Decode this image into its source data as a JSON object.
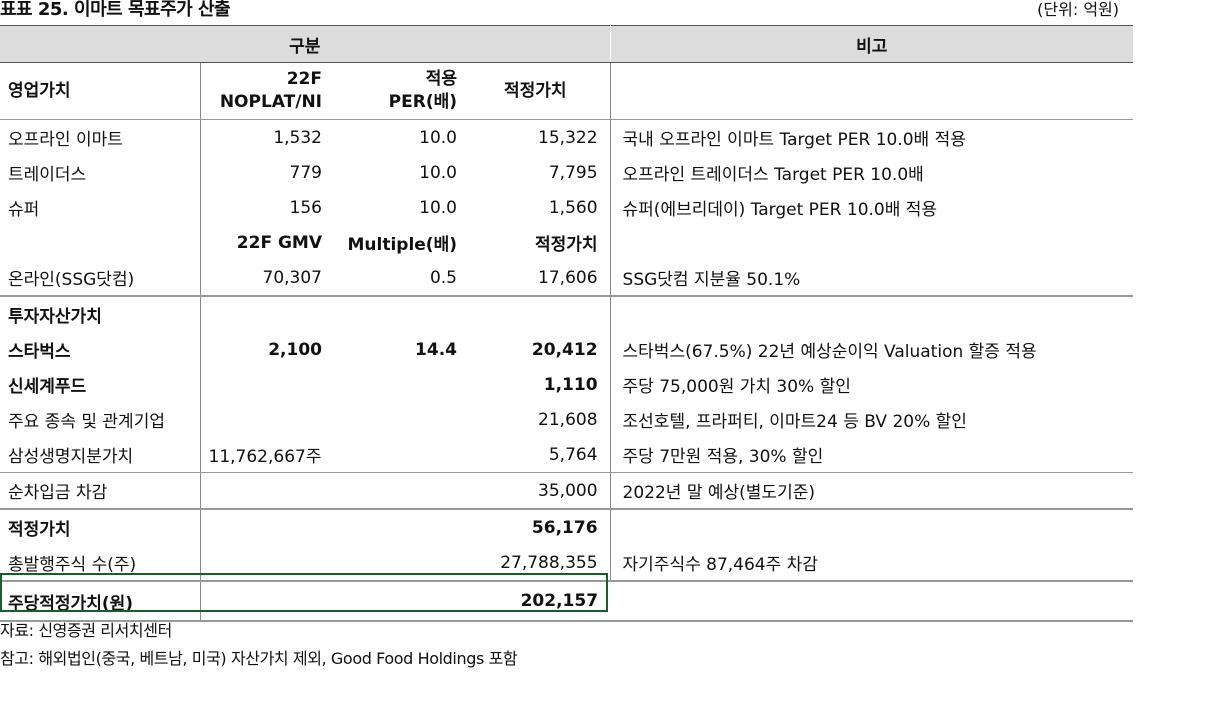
{
  "title": "표표 25. 이마트 목표주가 산출",
  "unit": "(단위: 억원)",
  "header": {
    "left": "구분",
    "right": "비고"
  },
  "column_header": {
    "label": "영업가치",
    "col1": [
      "22F",
      "NOPLAT/NI"
    ],
    "col2": [
      "적용",
      "PER(배)"
    ],
    "col3": "적정가치"
  },
  "rows": [
    {
      "c0": "오프라인 이마트",
      "c1": "1,532",
      "c2": "10.0",
      "c3": "15,322",
      "c4": "국내 오프라인 이마트 Target PER 10.0배 적용"
    },
    {
      "c0": "트레이더스",
      "c1": "779",
      "c2": "10.0",
      "c3": "7,795",
      "c4": "오프라인 트레이더스 Target PER 10.0배"
    },
    {
      "c0": "슈퍼",
      "c1": "156",
      "c2": "10.0",
      "c3": "1,560",
      "c4": "슈퍼(에브리데이) Target PER 10.0배 적용"
    },
    {
      "c0": "",
      "c1": "22F GMV",
      "c2": "Multiple(배)",
      "c3": "적정가치",
      "c4": ""
    },
    {
      "c0": "온라인(SSG닷컴)",
      "c1": "70,307",
      "c2": "0.5",
      "c3": "17,606",
      "c4": "SSG닷컴 지분율 50.1%"
    },
    {
      "c0": "투자자산가치",
      "c1": "",
      "c2": "",
      "c3": "",
      "c4": ""
    },
    {
      "c0": "스타벅스",
      "c1": "2,100",
      "c2": "14.4",
      "c3": "20,412",
      "c4": "스타벅스(67.5%) 22년 예상순이익 Valuation 할증 적용"
    },
    {
      "c0": "신세계푸드",
      "c1": "",
      "c2": "",
      "c3": "1,110",
      "c4": "주당 75,000원 가치 30% 할인"
    },
    {
      "c0": "주요 종속 및 관계기업",
      "c1": "",
      "c2": "",
      "c3": "21,608",
      "c4": "조선호텔, 프라퍼티, 이마트24 등 BV 20% 할인"
    },
    {
      "c0": "삼성생명지분가치",
      "c1": "11,762,667주",
      "c2": "",
      "c3": "5,764",
      "c4": "주당 7만원 적용, 30% 할인"
    },
    {
      "c0": "순차입금 차감",
      "c1": "",
      "c2": "",
      "c3": "35,000",
      "c4": "2022년 말 예상(별도기준)"
    },
    {
      "c0": "적정가치",
      "c1": "",
      "c2": "",
      "c3": "56,176",
      "c4": ""
    },
    {
      "c0": "총발행주식 수(주)",
      "c1": "",
      "c2": "",
      "c3": "27,788,355",
      "c4": "자기주식수 87,464주 차감"
    },
    {
      "c0": "주당적정가치(원)",
      "c1": "",
      "c2": "",
      "c3": "202,157",
      "c4": ""
    }
  ],
  "notes": {
    "source": "자료: 신영증권 리서치센터",
    "remark": "참고: 해외법인(중국, 베트남, 미국) 자산가치 제외, Good Food Holdings 포함"
  },
  "colors": {
    "header_bg": "#dcdcdc",
    "highlight_border": "#1a5c2a"
  }
}
